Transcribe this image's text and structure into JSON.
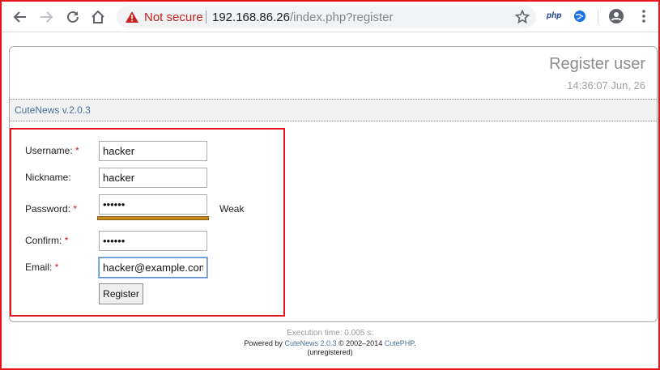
{
  "browser": {
    "security_label": "Not secure",
    "url_host": "192.168.86.26",
    "url_path": "/index.php?register",
    "extension_php_label": "php"
  },
  "header": {
    "title": "Register user",
    "time": "14:36:07 Jun, 26"
  },
  "version_bar": {
    "label": "CuteNews v.2.0.3"
  },
  "form": {
    "username_label": "Username:",
    "username_value": "hacker",
    "nickname_label": "Nickname:",
    "nickname_value": "hacker",
    "password_label": "Password:",
    "password_value": "hacker",
    "password_strength": "Weak",
    "confirm_label": "Confirm:",
    "confirm_value": "hacker",
    "email_label": "Email:",
    "email_value": "hacker@example.com",
    "required_marker": "*",
    "register_label": "Register"
  },
  "footer": {
    "exec_time": "Execution time: 0.005 s.",
    "powered_prefix": "Powered by",
    "powered_link": "CuteNews 2.0.3",
    "powered_middle": "© 2002–2014",
    "powered_link2": "CutePHP",
    "powered_suffix": ".",
    "unregistered": "(unregistered)"
  },
  "colors": {
    "accent_red": "#e8141b",
    "link_blue": "#4a6e9c",
    "strength_weak": "#c8861e"
  }
}
